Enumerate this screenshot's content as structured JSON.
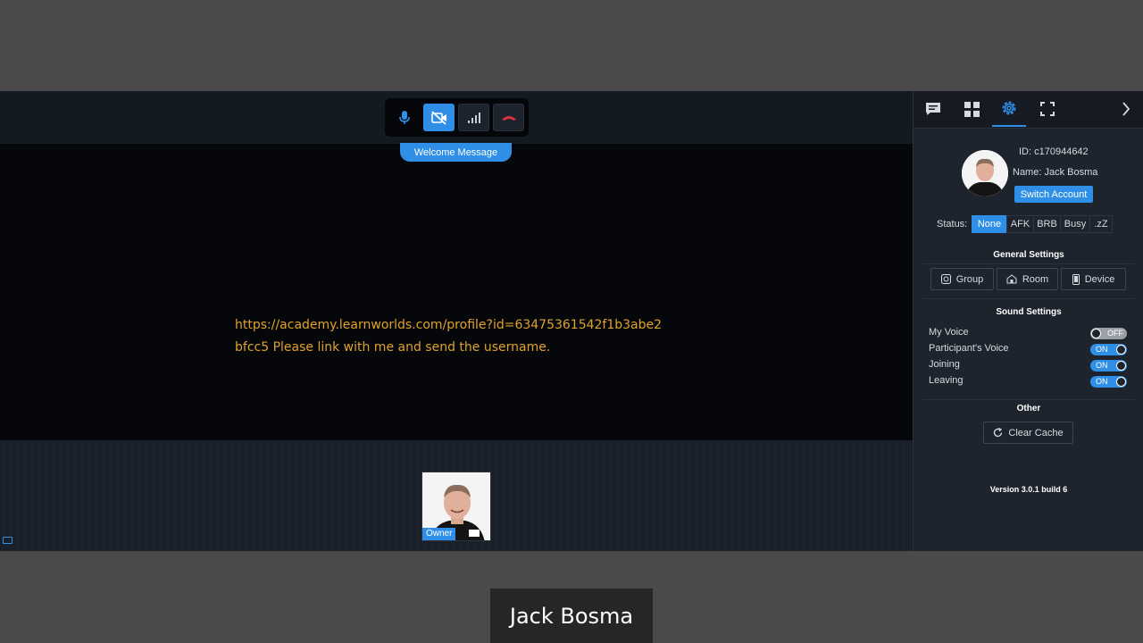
{
  "toolbar": {
    "buttons": [
      {
        "icon": "microphone-icon",
        "state": "on"
      },
      {
        "icon": "camera-off-icon",
        "state": "active"
      },
      {
        "icon": "signal-icon",
        "state": "normal"
      },
      {
        "icon": "hang-up-icon",
        "state": "normal"
      }
    ]
  },
  "stage": {
    "welcome_label": "Welcome Message",
    "message": "https://academy.learnworlds.com/profile?id=63475361542f1b3abe2bfcc5 Please link with me and send the username."
  },
  "participant": {
    "role_label": "Owner"
  },
  "panel": {
    "tabs": [
      "chat-icon",
      "grid-icon",
      "settings-icon",
      "fullscreen-icon"
    ],
    "collapse_icon": "chevron-right-icon",
    "profile": {
      "id_text": "ID: c170944642",
      "name_text": "Name: Jack Bosma",
      "switch_label": "Switch Account"
    },
    "status": {
      "label": "Status:",
      "options": [
        "None",
        "AFK",
        "BRB",
        "Busy",
        ".zZ"
      ],
      "selected": "None"
    },
    "general": {
      "title": "General Settings",
      "buttons": [
        "Group",
        "Room",
        "Device"
      ]
    },
    "sound": {
      "title": "Sound Settings",
      "items": [
        {
          "label": "My Voice",
          "state": "OFF"
        },
        {
          "label": "Participant's Voice",
          "state": "ON"
        },
        {
          "label": "Joining",
          "state": "ON"
        },
        {
          "label": "Leaving",
          "state": "ON"
        }
      ]
    },
    "other": {
      "title": "Other",
      "clear_label": "Clear Cache"
    },
    "version": "Version 3.0.1 build 6"
  },
  "caption": "Jack Bosma",
  "colors": {
    "accent": "#2f8fe6",
    "message": "#e0a22a",
    "hangup": "#d8323c"
  }
}
